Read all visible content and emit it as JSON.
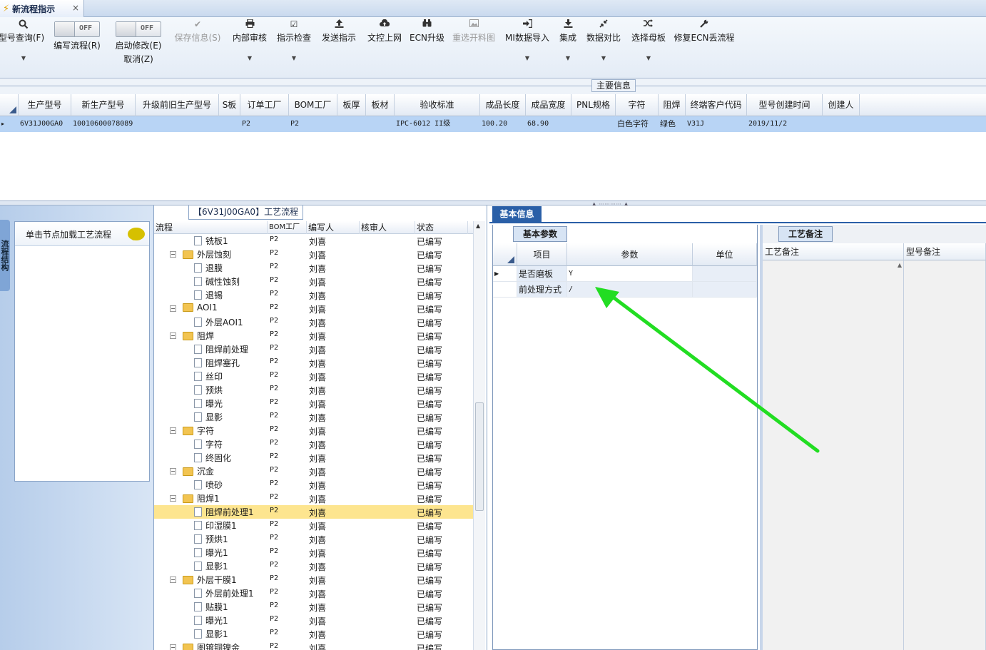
{
  "tab": {
    "title": "新流程指示",
    "close": "×"
  },
  "toolbar": {
    "query": {
      "label": "型号查询(F)"
    },
    "edit_flow": {
      "label": "编写流程(R)",
      "state": "OFF"
    },
    "enable_modify": {
      "label": "启动修改(E)",
      "sub": "取消(Z)",
      "state": "OFF"
    },
    "save": {
      "label": "保存信息(S)"
    },
    "internal_review": {
      "label": "内部审核"
    },
    "check": {
      "label": "指示检查"
    },
    "send": {
      "label": "发送指示"
    },
    "doc_upload": {
      "label": "文控上网"
    },
    "ecn": {
      "label": "ECN升级"
    },
    "reselect": {
      "label": "重选开料图"
    },
    "mi_import": {
      "label": "MI数据导入"
    },
    "integrate": {
      "label": "集成"
    },
    "compare": {
      "label": "数据对比"
    },
    "mother": {
      "label": "选择母板"
    },
    "repair": {
      "label": "修复ECN丢流程"
    }
  },
  "main_info": {
    "label": "主要信息"
  },
  "top_grid": {
    "columns": [
      "生产型号",
      "新生产型号",
      "升级前旧生产型号",
      "S板",
      "订单工厂",
      "BOM工厂",
      "板厚",
      "板材",
      "验收标准",
      "成品长度",
      "成品宽度",
      "PNL规格",
      "字符",
      "阻焊",
      "终端客户代码",
      "型号创建时间",
      "创建人"
    ],
    "row": [
      "6V31J00GA0",
      "10010600078089",
      "",
      "",
      "P2",
      "P2",
      "",
      "",
      "IPC-6012 II级",
      "100.20",
      "68.90",
      "",
      "白色字符",
      "绿色",
      "V31J",
      "2019/11/2",
      ""
    ]
  },
  "left_nav": {
    "vertical_tab": "流程结构",
    "hint": "单击节点加载工艺流程"
  },
  "process": {
    "title": "【6V31J00GA0】工艺流程",
    "columns": [
      "流程",
      "BOM工厂",
      "编写人",
      "核审人",
      "状态"
    ],
    "rows": [
      {
        "name": "铣板1",
        "level": 1,
        "type": "file",
        "bom": "P2",
        "author": "刘喜",
        "status": "已编写"
      },
      {
        "name": "外层蚀刻",
        "level": 0,
        "type": "folder",
        "bom": "P2",
        "author": "刘喜",
        "status": "已编写"
      },
      {
        "name": "退膜",
        "level": 1,
        "type": "file",
        "bom": "P2",
        "author": "刘喜",
        "status": "已编写"
      },
      {
        "name": "碱性蚀刻",
        "level": 1,
        "type": "file",
        "bom": "P2",
        "author": "刘喜",
        "status": "已编写"
      },
      {
        "name": "退锡",
        "level": 1,
        "type": "file",
        "bom": "P2",
        "author": "刘喜",
        "status": "已编写"
      },
      {
        "name": "AOI1",
        "level": 0,
        "type": "folder",
        "bom": "P2",
        "author": "刘喜",
        "status": "已编写"
      },
      {
        "name": "外层AOI1",
        "level": 1,
        "type": "file",
        "bom": "P2",
        "author": "刘喜",
        "status": "已编写"
      },
      {
        "name": "阻焊",
        "level": 0,
        "type": "folder",
        "bom": "P2",
        "author": "刘喜",
        "status": "已编写"
      },
      {
        "name": "阻焊前处理",
        "level": 1,
        "type": "file",
        "bom": "P2",
        "author": "刘喜",
        "status": "已编写"
      },
      {
        "name": "阻焊塞孔",
        "level": 1,
        "type": "file",
        "bom": "P2",
        "author": "刘喜",
        "status": "已编写"
      },
      {
        "name": "丝印",
        "level": 1,
        "type": "file",
        "bom": "P2",
        "author": "刘喜",
        "status": "已编写"
      },
      {
        "name": "预烘",
        "level": 1,
        "type": "file",
        "bom": "P2",
        "author": "刘喜",
        "status": "已编写"
      },
      {
        "name": "曝光",
        "level": 1,
        "type": "file",
        "bom": "P2",
        "author": "刘喜",
        "status": "已编写"
      },
      {
        "name": "显影",
        "level": 1,
        "type": "file",
        "bom": "P2",
        "author": "刘喜",
        "status": "已编写"
      },
      {
        "name": "字符",
        "level": 0,
        "type": "folder",
        "bom": "P2",
        "author": "刘喜",
        "status": "已编写"
      },
      {
        "name": "字符",
        "level": 1,
        "type": "file",
        "bom": "P2",
        "author": "刘喜",
        "status": "已编写"
      },
      {
        "name": "终固化",
        "level": 1,
        "type": "file",
        "bom": "P2",
        "author": "刘喜",
        "status": "已编写"
      },
      {
        "name": "沉金",
        "level": 0,
        "type": "folder",
        "bom": "P2",
        "author": "刘喜",
        "status": "已编写"
      },
      {
        "name": "喷砂",
        "level": 1,
        "type": "file",
        "bom": "P2",
        "author": "刘喜",
        "status": "已编写"
      },
      {
        "name": "阻焊1",
        "level": 0,
        "type": "folder",
        "bom": "P2",
        "author": "刘喜",
        "status": "已编写"
      },
      {
        "name": "阻焊前处理1",
        "level": 1,
        "type": "file",
        "bom": "P2",
        "author": "刘喜",
        "status": "已编写",
        "selected": true
      },
      {
        "name": "印湿膜1",
        "level": 1,
        "type": "file",
        "bom": "P2",
        "author": "刘喜",
        "status": "已编写"
      },
      {
        "name": "预烘1",
        "level": 1,
        "type": "file",
        "bom": "P2",
        "author": "刘喜",
        "status": "已编写"
      },
      {
        "name": "曝光1",
        "level": 1,
        "type": "file",
        "bom": "P2",
        "author": "刘喜",
        "status": "已编写"
      },
      {
        "name": "显影1",
        "level": 1,
        "type": "file",
        "bom": "P2",
        "author": "刘喜",
        "status": "已编写"
      },
      {
        "name": "外层干膜1",
        "level": 0,
        "type": "folder",
        "bom": "P2",
        "author": "刘喜",
        "status": "已编写"
      },
      {
        "name": "外层前处理1",
        "level": 1,
        "type": "file",
        "bom": "P2",
        "author": "刘喜",
        "status": "已编写"
      },
      {
        "name": "贴膜1",
        "level": 1,
        "type": "file",
        "bom": "P2",
        "author": "刘喜",
        "status": "已编写"
      },
      {
        "name": "曝光1",
        "level": 1,
        "type": "file",
        "bom": "P2",
        "author": "刘喜",
        "status": "已编写"
      },
      {
        "name": "显影1",
        "level": 1,
        "type": "file",
        "bom": "P2",
        "author": "刘喜",
        "status": "已编写"
      },
      {
        "name": "图镀铜镍金",
        "level": 0,
        "type": "folder",
        "bom": "P2",
        "author": "刘喜",
        "status": "已编写"
      }
    ]
  },
  "basic_info": {
    "tab": "基本信息",
    "param_tab": "基本参数",
    "columns": [
      "项目",
      "参数",
      "单位"
    ],
    "rows": [
      {
        "item": "是否磨板",
        "value": "Y",
        "unit": ""
      },
      {
        "item": "前处理方式",
        "value": "/",
        "unit": ""
      }
    ],
    "remarks_tab": "工艺备注",
    "remark_cols": [
      "工艺备注",
      "型号备注"
    ]
  },
  "annotation": {
    "color": "#22dd22"
  }
}
